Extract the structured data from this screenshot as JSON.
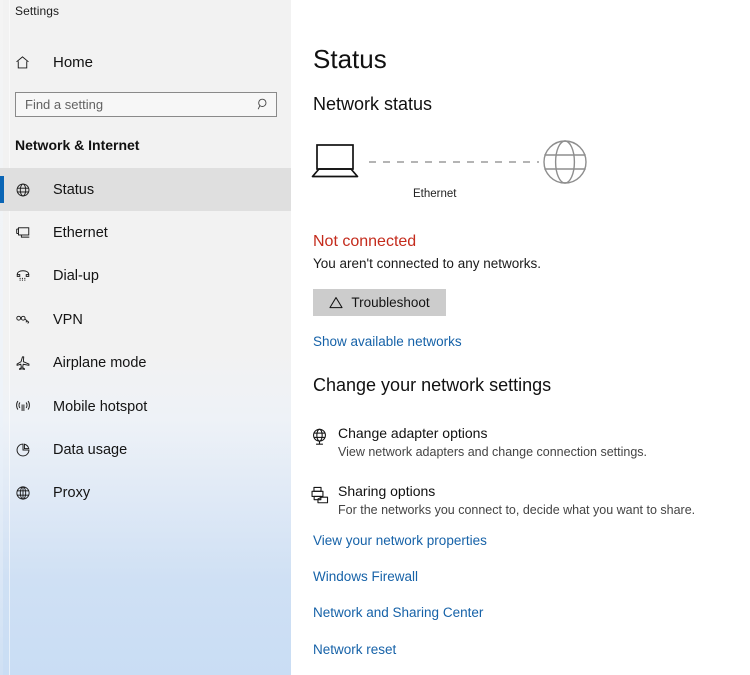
{
  "app": {
    "title": "Settings"
  },
  "sidebar": {
    "home_label": "Home",
    "home_icon": "home-icon",
    "search": {
      "placeholder": "Find a setting",
      "value": "",
      "icon": "search-icon"
    },
    "category": "Network & Internet",
    "accent_color": "#0a65b5",
    "selected_bg": "#dfdfdf",
    "items": [
      {
        "label": "Status",
        "icon": "globe-status-icon",
        "selected": true
      },
      {
        "label": "Ethernet",
        "icon": "ethernet-icon",
        "selected": false
      },
      {
        "label": "Dial-up",
        "icon": "dialup-phone-icon",
        "selected": false
      },
      {
        "label": "VPN",
        "icon": "vpn-key-icon",
        "selected": false
      },
      {
        "label": "Airplane mode",
        "icon": "airplane-icon",
        "selected": false
      },
      {
        "label": "Mobile hotspot",
        "icon": "hotspot-icon",
        "selected": false
      },
      {
        "label": "Data usage",
        "icon": "pie-chart-icon",
        "selected": false
      },
      {
        "label": "Proxy",
        "icon": "globe-icon",
        "selected": false
      }
    ]
  },
  "main": {
    "page_title": "Status",
    "network_status_title": "Network status",
    "diagram": {
      "device_icon": "laptop-icon",
      "connection_label": "Ethernet",
      "internet_icon": "globe-icon",
      "connected": false
    },
    "status": {
      "headline": "Not connected",
      "headline_color": "#c42b1c",
      "description": "You aren't connected to any networks."
    },
    "troubleshoot_button": {
      "label": "Troubleshoot",
      "icon": "warning-triangle-icon"
    },
    "show_networks_link": "Show available networks",
    "change_settings_title": "Change your network settings",
    "options": [
      {
        "name": "Change adapter options",
        "description": "View network adapters and change connection settings.",
        "icon": "network-adapter-icon"
      },
      {
        "name": "Sharing options",
        "description": "For the networks you connect to, decide what you want to share.",
        "icon": "sharing-icon"
      }
    ],
    "links": [
      "View your network properties",
      "Windows Firewall",
      "Network and Sharing Center",
      "Network reset"
    ],
    "link_color": "#1662a8"
  }
}
